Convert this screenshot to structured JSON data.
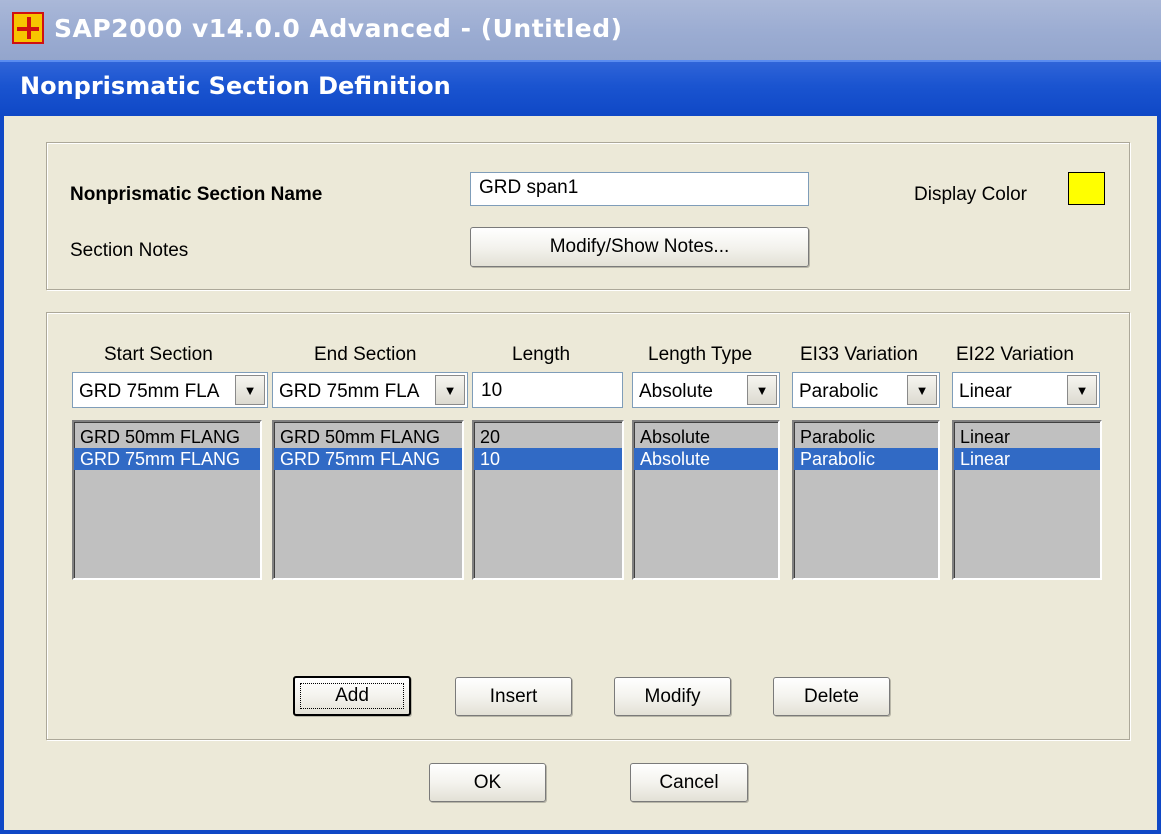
{
  "app": {
    "title": "SAP2000 v14.0.0 Advanced  - (Untitled)"
  },
  "dialog": {
    "title": "Nonprismatic Section Definition"
  },
  "section": {
    "name_label": "Nonprismatic Section Name",
    "name_value": "GRD span1",
    "display_color_label": "Display Color",
    "display_color": "#ffff00",
    "notes_label": "Section Notes",
    "notes_button": "Modify/Show Notes..."
  },
  "columns": {
    "start_section": {
      "header": "Start Section",
      "current": "GRD 75mm FLA",
      "items": [
        "GRD 50mm FLANG",
        "GRD 75mm FLANG"
      ]
    },
    "end_section": {
      "header": "End Section",
      "current": "GRD 75mm FLA",
      "items": [
        "GRD 50mm FLANG",
        "GRD 75mm FLANG"
      ]
    },
    "length": {
      "header": "Length",
      "current": "10",
      "items": [
        "20",
        "10"
      ]
    },
    "length_type": {
      "header": "Length Type",
      "current": "Absolute",
      "items": [
        "Absolute",
        "Absolute"
      ]
    },
    "ei33": {
      "header": "EI33 Variation",
      "current": "Parabolic",
      "items": [
        "Parabolic",
        "Parabolic"
      ]
    },
    "ei22": {
      "header": "EI22 Variation",
      "current": "Linear",
      "items": [
        "Linear",
        "Linear"
      ]
    }
  },
  "selected_row": 1,
  "buttons": {
    "add": "Add",
    "insert": "Insert",
    "modify": "Modify",
    "delete": "Delete",
    "ok": "OK",
    "cancel": "Cancel"
  },
  "colors": {
    "title_bar": "#0f48c6",
    "selection": "#316ac5",
    "dialog_bg": "#ece9d8",
    "list_bg": "#c0c0c0"
  }
}
